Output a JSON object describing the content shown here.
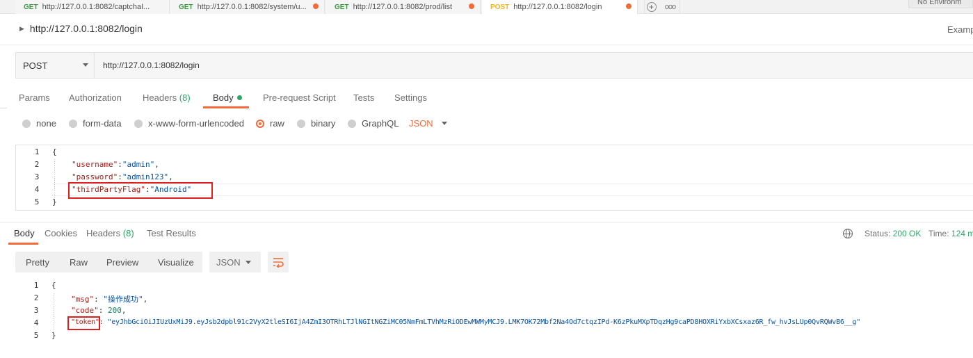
{
  "tabs": [
    {
      "method": "GET",
      "url": "http://127.0.0.1:8082/captchaI..."
    },
    {
      "method": "GET",
      "url": "http://127.0.0.1:8082/system/u..."
    },
    {
      "method": "GET",
      "url": "http://127.0.0.1:8082/prod/list"
    },
    {
      "method": "POST",
      "url": "http://127.0.0.1:8082/login"
    }
  ],
  "tab_more": "ooo",
  "environment": "No Environm",
  "request": {
    "name": "http://127.0.0.1:8082/login",
    "examples_label": "Examp",
    "method": "POST",
    "url": "http://127.0.0.1:8082/login"
  },
  "request_tabs": {
    "params": "Params",
    "authorization": "Authorization",
    "headers": "Headers",
    "headers_count": "(8)",
    "body": "Body",
    "prerequest": "Pre-request Script",
    "tests": "Tests",
    "settings": "Settings"
  },
  "body_types": {
    "none": "none",
    "form_data": "form-data",
    "urlencoded": "x-www-form-urlencoded",
    "raw": "raw",
    "binary": "binary",
    "graphql": "GraphQL",
    "format": "JSON"
  },
  "request_body": {
    "line_numbers": [
      "1",
      "2",
      "3",
      "4",
      "5"
    ],
    "open": "{",
    "close": "}",
    "lines": [
      {
        "key": "\"username\"",
        "sep": ":",
        "value": "\"admin\"",
        "end": ","
      },
      {
        "key": "\"password\"",
        "sep": ":",
        "value": "\"admin123\"",
        "end": ","
      },
      {
        "key": "\"thirdPartyFlag\"",
        "sep": ":",
        "value": "\"Android\"",
        "end": ""
      }
    ]
  },
  "response_tabs": {
    "body": "Body",
    "cookies": "Cookies",
    "headers": "Headers",
    "headers_count": "(8)",
    "test_results": "Test Results"
  },
  "status": {
    "status_label": "Status:",
    "status_value": "200 OK",
    "time_label": "Time:",
    "time_value": "124 m"
  },
  "view_modes": {
    "pretty": "Pretty",
    "raw": "Raw",
    "preview": "Preview",
    "visualize": "Visualize",
    "format": "JSON"
  },
  "response_body": {
    "line_numbers": [
      "1",
      "2",
      "3",
      "4",
      "5"
    ],
    "open": "{",
    "close": "}",
    "msg_key": "\"msg\"",
    "msg_value": "\"操作成功\"",
    "code_key": "\"code\"",
    "code_value": "200",
    "token_key": "\"token\"",
    "token_value": "\"eyJhbGciOiJIUzUxMiJ9.eyJsb2dpbl91c2VyX2tleSI6IjA4ZmI3OTRhLTJlNGItNGZiMC05NmFmLTVhMzRiODEwMWMyMCJ9.LMK7OK72Mbf2Na4Od7ctqzIPd-K6zPkuMXpTDqzHg9caPD8HOXRiYxbXCsxaz6R_fw_hvJsLUp0QvRQWvB6__g\""
  },
  "colors": {
    "accent": "#f26b3a",
    "success": "#2aa665",
    "highlight_box": "#e02020"
  }
}
